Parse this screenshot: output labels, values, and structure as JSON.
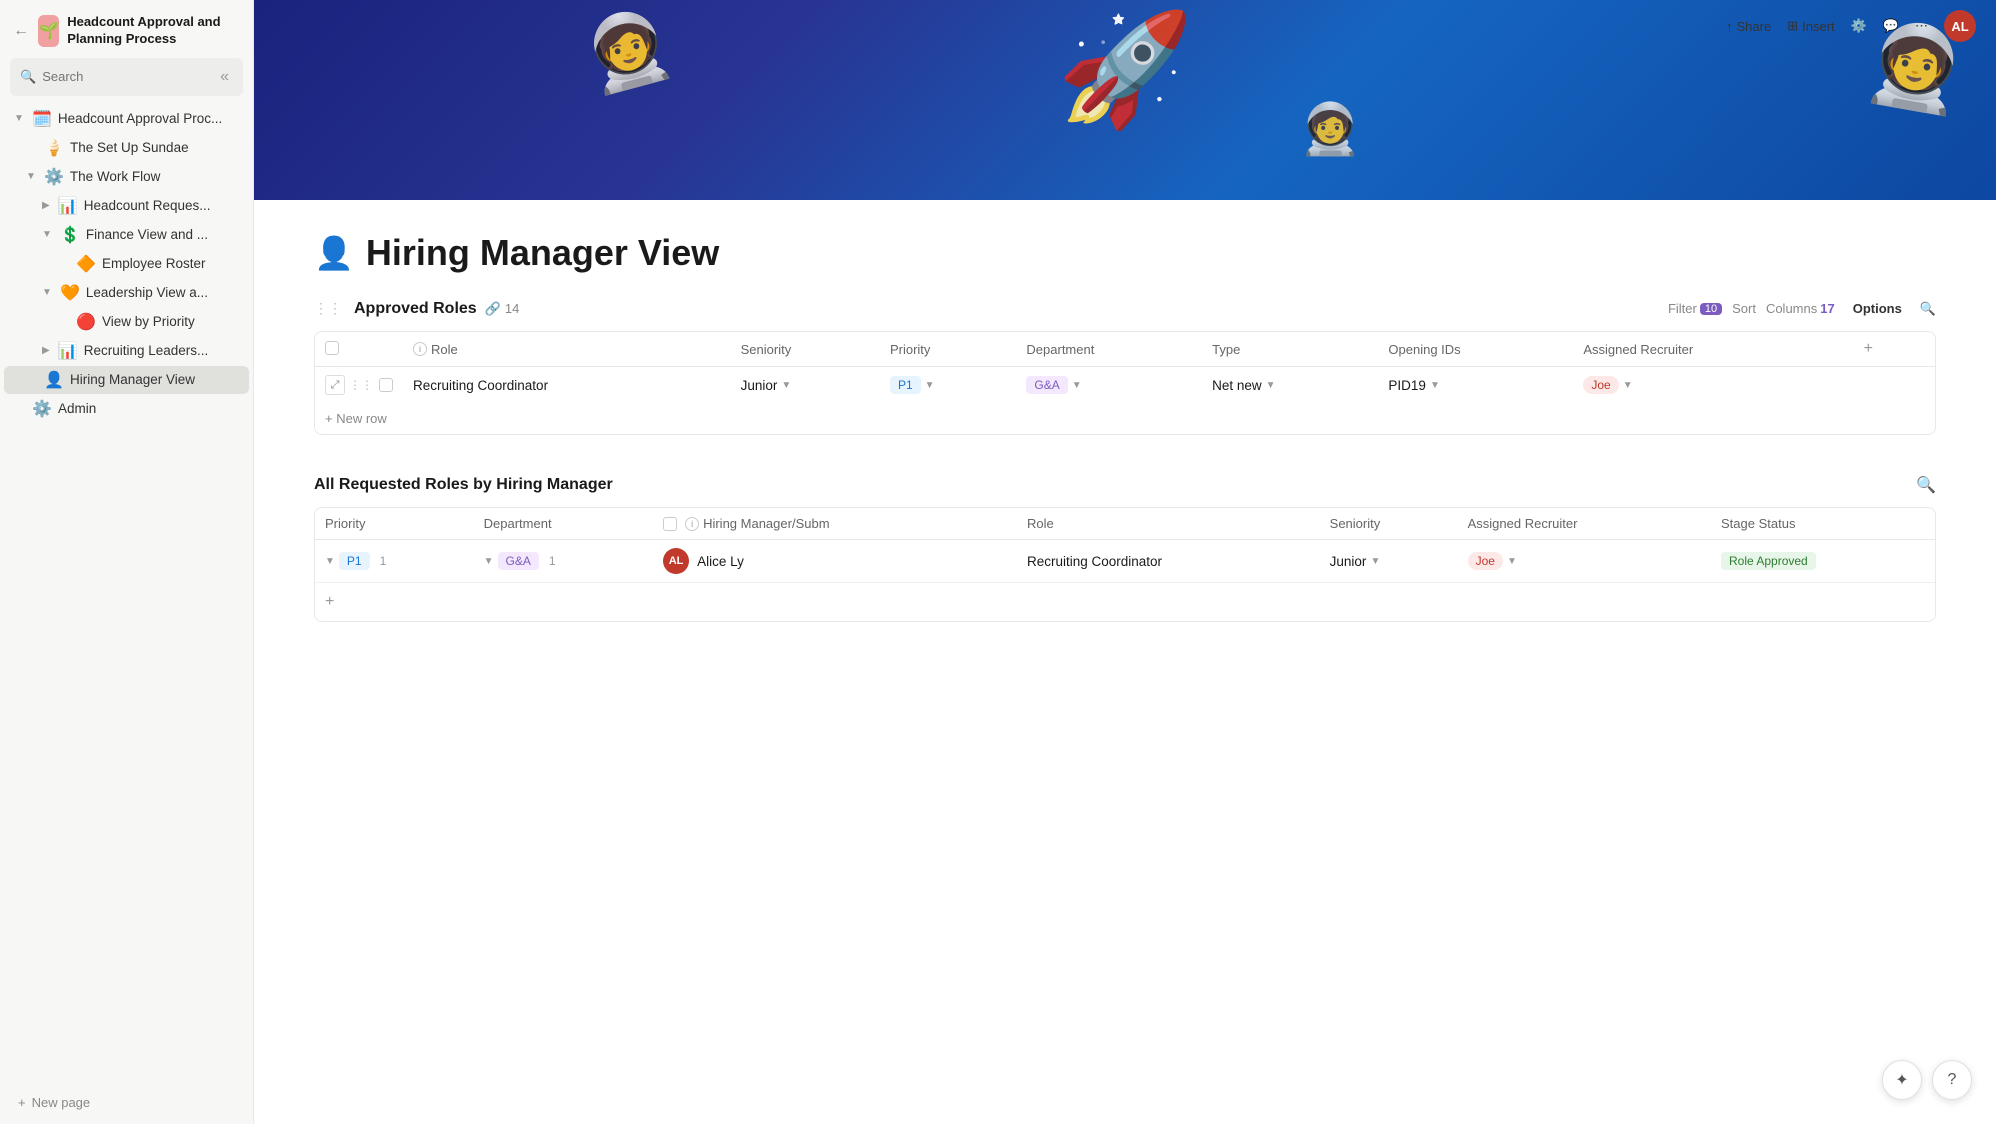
{
  "app": {
    "title": "Headcount Approval and Planning Process",
    "logo_emoji": "🌱",
    "avatar_initials": "AL"
  },
  "topbar": {
    "share_label": "Share",
    "insert_label": "Insert"
  },
  "search": {
    "placeholder": "Search"
  },
  "sidebar": {
    "collapse_icon": "«",
    "items": [
      {
        "id": "headcount-approval",
        "label": "Headcount Approval Proc...",
        "icon": "🗓️",
        "indent": 0,
        "has_chevron": true,
        "chevron_open": true
      },
      {
        "id": "setup-sundae",
        "label": "The Set Up Sundae",
        "icon": "🍦",
        "indent": 1,
        "has_chevron": false
      },
      {
        "id": "workflow",
        "label": "The Work Flow",
        "icon": "⚙️",
        "indent": 1,
        "has_chevron": true,
        "chevron_open": true
      },
      {
        "id": "headcount-reques",
        "label": "Headcount Reques...",
        "icon": "📊",
        "indent": 2,
        "has_chevron": true
      },
      {
        "id": "finance-view",
        "label": "Finance View and ...",
        "icon": "💲",
        "indent": 2,
        "has_chevron": true,
        "chevron_open": true
      },
      {
        "id": "employee-roster",
        "label": "Employee Roster",
        "icon": "🔶",
        "indent": 3,
        "has_chevron": false
      },
      {
        "id": "leadership-view",
        "label": "Leadership View a...",
        "icon": "🧡",
        "indent": 2,
        "has_chevron": true,
        "chevron_open": true
      },
      {
        "id": "view-by-priority",
        "label": "View by Priority",
        "icon": "🔴",
        "indent": 3,
        "has_chevron": false
      },
      {
        "id": "recruiting-leaders",
        "label": "Recruiting Leaders...",
        "icon": "📊",
        "indent": 2,
        "has_chevron": true
      },
      {
        "id": "hiring-manager-view",
        "label": "Hiring Manager View",
        "icon": "👤",
        "indent": 1,
        "has_chevron": false,
        "active": true
      },
      {
        "id": "admin",
        "label": "Admin",
        "icon": "⚙️",
        "indent": 0,
        "has_chevron": false
      }
    ],
    "new_page_label": "New page"
  },
  "page": {
    "title": "Hiring Manager View",
    "title_icon": "👤"
  },
  "approved_roles": {
    "title": "Approved Roles",
    "count": "14",
    "link_icon": "🔗",
    "filter_label": "Filter",
    "filter_count": "10",
    "sort_label": "Sort",
    "columns_label": "Columns",
    "columns_count": "17",
    "options_label": "Options",
    "columns": [
      {
        "id": "role",
        "label": "Role"
      },
      {
        "id": "seniority",
        "label": "Seniority"
      },
      {
        "id": "priority",
        "label": "Priority"
      },
      {
        "id": "department",
        "label": "Department"
      },
      {
        "id": "type",
        "label": "Type"
      },
      {
        "id": "opening-ids",
        "label": "Opening IDs"
      },
      {
        "id": "assigned-recruiter",
        "label": "Assigned Recruiter"
      }
    ],
    "rows": [
      {
        "role": "Recruiting Coordinator",
        "seniority": "Junior",
        "priority": "P1",
        "department": "G&A",
        "type": "Net new",
        "opening_ids": "PID19",
        "assigned_recruiter": "Joe"
      }
    ],
    "new_row_label": "+ New row"
  },
  "all_requested_roles": {
    "title": "All Requested Roles by Hiring Manager",
    "columns": [
      {
        "id": "priority",
        "label": "Priority"
      },
      {
        "id": "department",
        "label": "Department"
      },
      {
        "id": "hiring-manager",
        "label": "Hiring Manager/Subm"
      },
      {
        "id": "role",
        "label": "Role"
      },
      {
        "id": "seniority",
        "label": "Seniority"
      },
      {
        "id": "assigned-recruiter",
        "label": "Assigned Recruiter"
      },
      {
        "id": "stage-status",
        "label": "Stage Status"
      }
    ],
    "rows": [
      {
        "priority": "P1",
        "priority_count": "1",
        "department": "G&A",
        "dept_count": "1",
        "hiring_manager": "Alice Ly",
        "role": "Recruiting Coordinator",
        "seniority": "Junior",
        "assigned_recruiter": "Joe",
        "stage_status": "Role Approved"
      }
    ]
  },
  "float_btns": {
    "ai_icon": "✦",
    "help_icon": "?"
  }
}
